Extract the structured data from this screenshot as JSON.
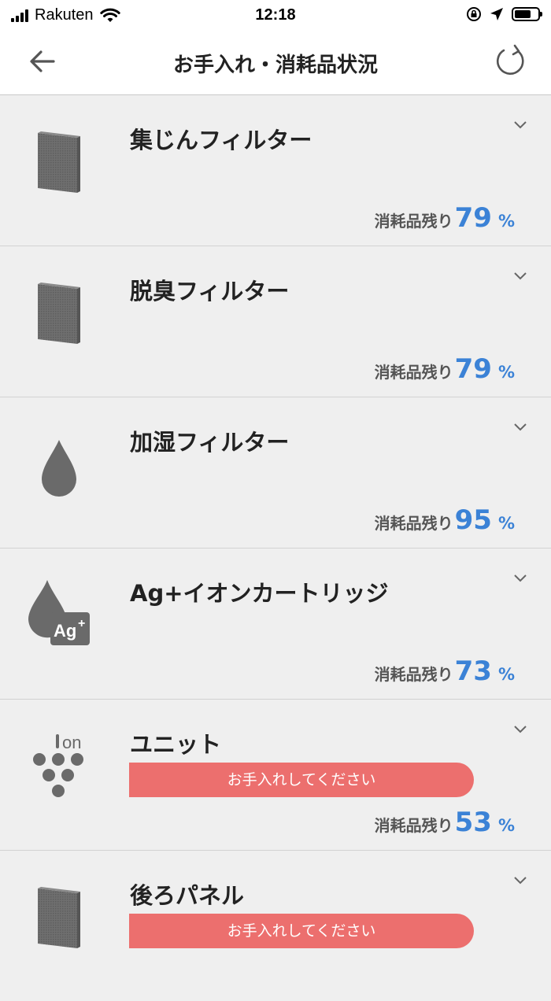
{
  "status_bar": {
    "carrier": "Rakuten",
    "time": "12:18"
  },
  "nav": {
    "title": "お手入れ・消耗品状況",
    "back_icon": "arrow-left-icon",
    "refresh_icon": "refresh-icon"
  },
  "items": [
    {
      "name": "集じんフィルター",
      "remaining_label": "消耗品残り",
      "percent": "79",
      "unit": "%",
      "icon": "filter-icon"
    },
    {
      "name": "脱臭フィルター",
      "remaining_label": "消耗品残り",
      "percent": "79",
      "unit": "%",
      "icon": "filter-icon"
    },
    {
      "name": "加湿フィルター",
      "remaining_label": "消耗品残り",
      "percent": "95",
      "unit": "%",
      "icon": "water-drop-icon"
    },
    {
      "name": "Ag+イオンカートリッジ",
      "remaining_label": "消耗品残り",
      "percent": "73",
      "unit": "%",
      "icon": "ag-ion-cartridge-icon",
      "badge": "Ag",
      "badge_sup": "+"
    },
    {
      "name": "ユニット",
      "alert": "お手入れしてください",
      "remaining_label": "消耗品残り",
      "percent": "53",
      "unit": "%",
      "icon": "ion-unit-icon",
      "icon_text": "on"
    },
    {
      "name": "後ろパネル",
      "alert": "お手入れしてください",
      "icon": "panel-icon"
    }
  ]
}
